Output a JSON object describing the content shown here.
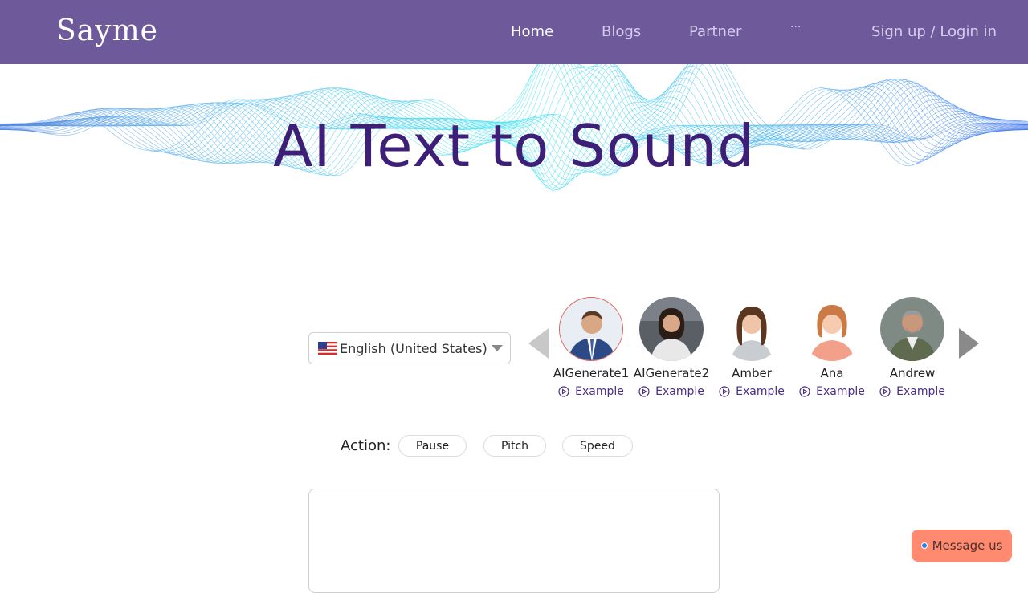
{
  "nav": {
    "logo": "Sayme",
    "items": [
      "Home",
      "Blogs",
      "Partner",
      "···"
    ],
    "signin": "Sign up / Login in"
  },
  "hero": {
    "title": "AI Text to Sound"
  },
  "language": {
    "selected": "English (United States)"
  },
  "voices": [
    {
      "name": "AIGenerate1",
      "example": "Example",
      "selected": true
    },
    {
      "name": "AIGenerate2",
      "example": "Example",
      "selected": false
    },
    {
      "name": "Amber",
      "example": "Example",
      "selected": false
    },
    {
      "name": "Ana",
      "example": "Example",
      "selected": false
    },
    {
      "name": "Andrew",
      "example": "Example",
      "selected": false
    }
  ],
  "actions": {
    "label": "Action:",
    "pause": "Pause",
    "pitch": "Pitch",
    "speed": "Speed"
  },
  "message_button": "Message us",
  "colors": {
    "nav_bg": "#6e5a9b",
    "title": "#3d1f78",
    "accent": "#4a2f86",
    "message_bg": "#ff8a70"
  }
}
